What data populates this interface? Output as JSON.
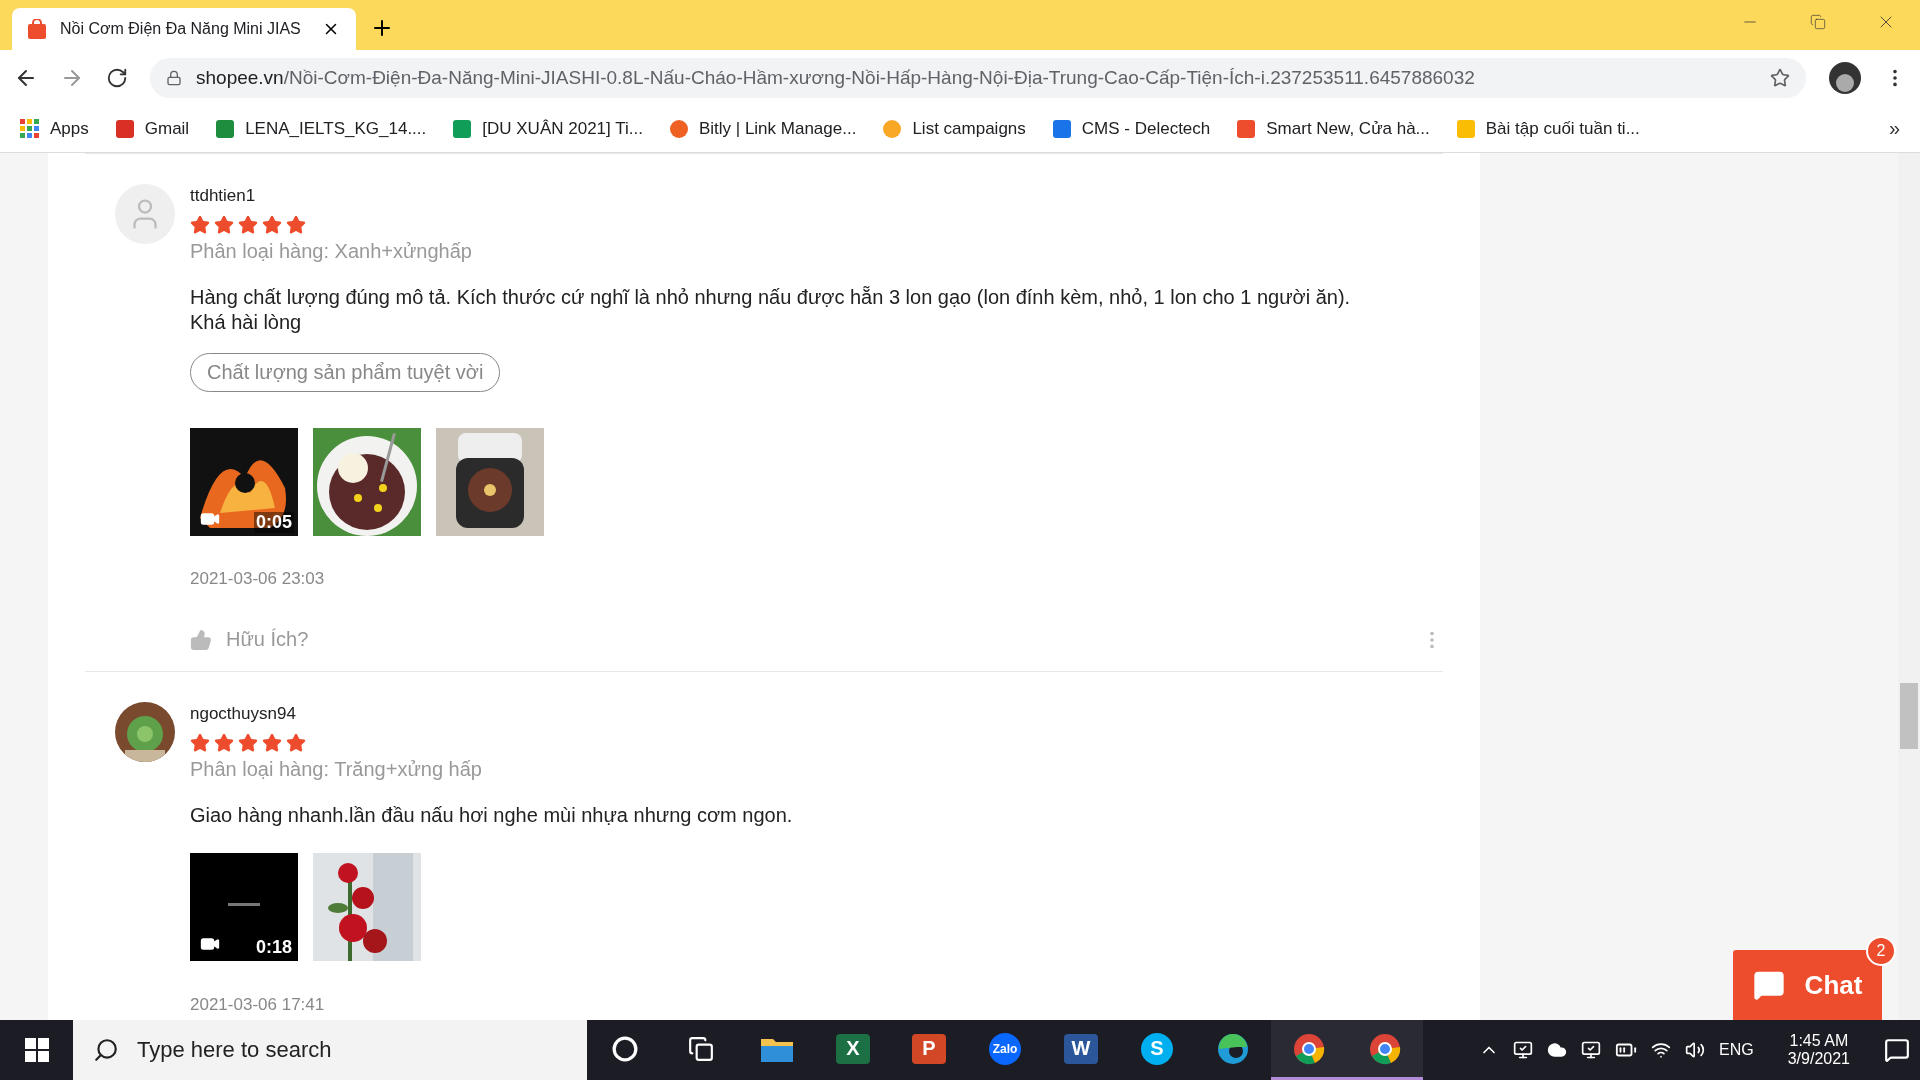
{
  "browser": {
    "tab": {
      "title": "Nồi Cơm Điện Đa Năng Mini JIAS",
      "selected": true
    },
    "address": {
      "domain": "shopee.vn",
      "path": "/Nồi-Cơm-Điện-Đa-Năng-Mini-JIASHI-0.8L-Nấu-Cháo-Hầm-xương-Nồi-Hấp-Hàng-Nội-Địa-Trung-Cao-Cấp-Tiện-Ích-i.237253511.6457886032"
    },
    "bookmarks": [
      {
        "kind": "apps",
        "label": "Apps"
      },
      {
        "kind": "gmail",
        "label": "Gmail"
      },
      {
        "kind": "classroom",
        "label": "LENA_IELTS_KG_14...."
      },
      {
        "kind": "sheets",
        "label": "[DU XUÂN 2021] Ti..."
      },
      {
        "kind": "bitly",
        "label": "Bitly | Link Manage..."
      },
      {
        "kind": "campaign",
        "label": "List campaigns"
      },
      {
        "kind": "cms",
        "label": "CMS - Delectech"
      },
      {
        "kind": "shopee",
        "label": "Smart New, Cửa hà..."
      },
      {
        "kind": "drive",
        "label": "Bài tập cuối tuần ti..."
      }
    ],
    "bookmarks_overflow": "»"
  },
  "reviews": [
    {
      "user": "ttdhtien1",
      "stars": 5,
      "variant": "Phân loại hàng: Xanh+xửnghấp",
      "text": "Hàng chất lượng đúng mô tả. Kích thước cứ nghĩ là nhỏ nhưng nấu được hẵn 3 lon gạo (lon đính kèm, nhỏ, 1 lon cho 1 người ăn). Khá hài lòng",
      "tags": [
        "Chất lượng sản phẩm tuyệt vời"
      ],
      "media": [
        {
          "kind": "video",
          "duration": "0:05"
        },
        {
          "kind": "picture"
        },
        {
          "kind": "picture"
        }
      ],
      "date": "2021-03-06 23:03",
      "helpful": "Hữu Ích?"
    },
    {
      "user": "ngocthuysn94",
      "stars": 5,
      "variant": "Phân loại hàng: Trăng+xửng hấp",
      "text": "Giao hàng nhanh.lần đầu nấu hơi nghe mùi nhựa nhưng cơm ngon.",
      "media": [
        {
          "kind": "video",
          "duration": "0:18"
        },
        {
          "kind": "picture"
        }
      ],
      "date": "2021-03-06 17:41"
    }
  ],
  "chat": {
    "label": "Chat",
    "badge": "2"
  },
  "taskbar": {
    "search_placeholder": "Type here to search",
    "apps": [
      {
        "kind": "cortana",
        "open": false
      },
      {
        "kind": "taskview",
        "open": false
      },
      {
        "kind": "explorer",
        "open": false
      },
      {
        "kind": "excel",
        "glyph": "X",
        "open": false
      },
      {
        "kind": "powerpoint",
        "glyph": "P",
        "open": false
      },
      {
        "kind": "zalo",
        "glyph": "Zalo",
        "open": false
      },
      {
        "kind": "word",
        "glyph": "W",
        "open": false
      },
      {
        "kind": "skype",
        "glyph": "S",
        "open": false
      },
      {
        "kind": "edge",
        "open": false
      },
      {
        "kind": "chrome",
        "open": true
      },
      {
        "kind": "chrome",
        "open": true
      }
    ],
    "language": "ENG",
    "time": "1:45 AM",
    "date": "3/9/2021"
  }
}
